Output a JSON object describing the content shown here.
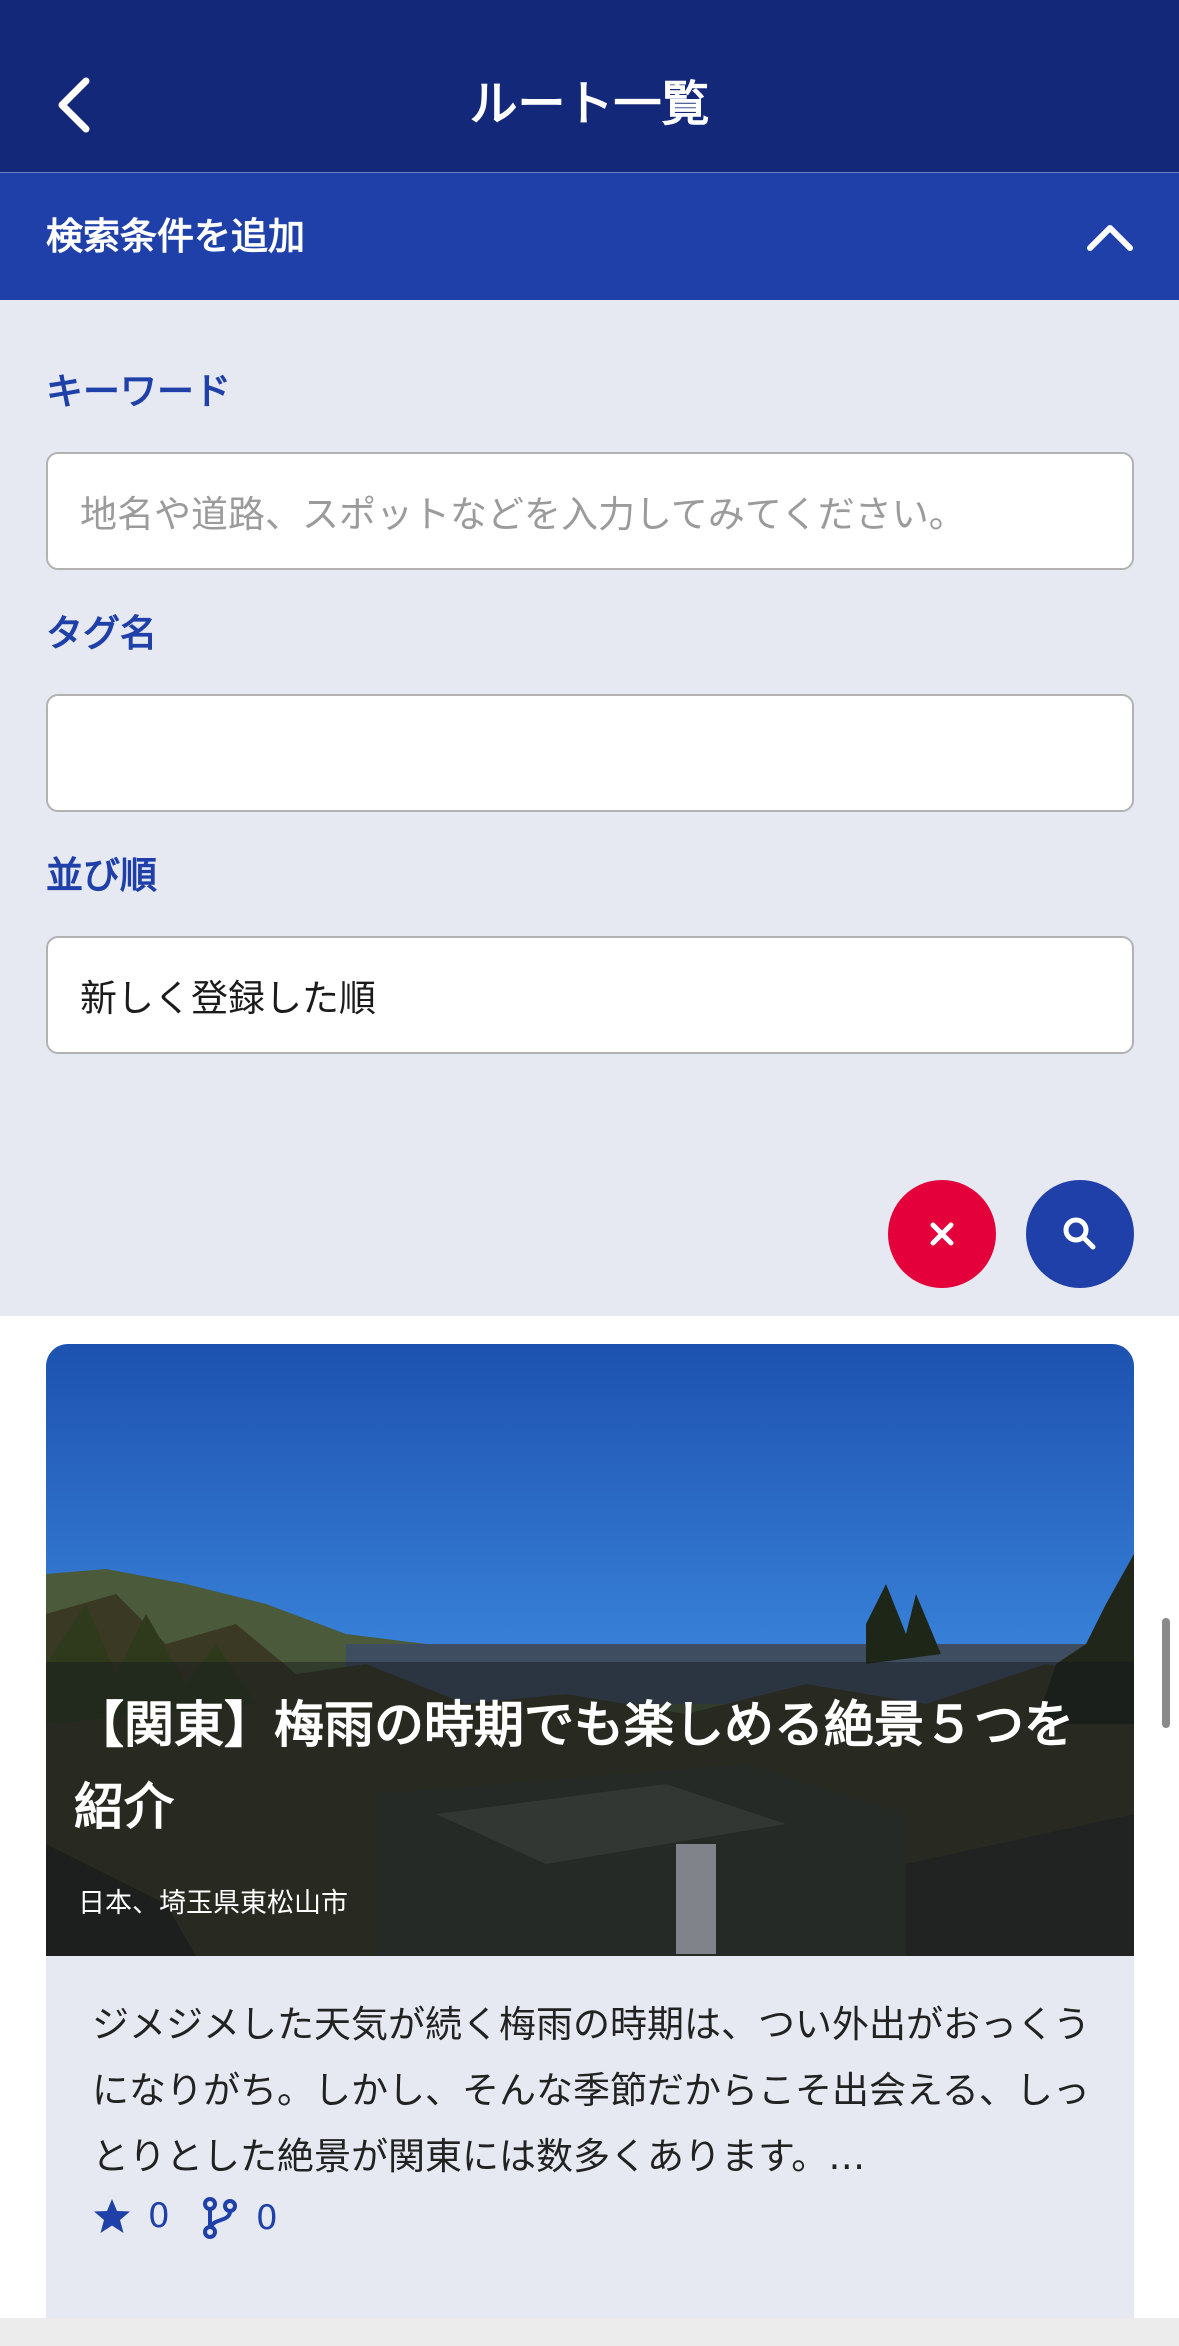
{
  "appbar": {
    "title": "ルート一覧",
    "back_icon": "chevron-left-icon"
  },
  "filter": {
    "header_label": "検索条件を追加",
    "collapse_icon": "chevron-up-icon",
    "keyword": {
      "label": "キーワード",
      "placeholder": "地名や道路、スポットなどを入力してみてください。",
      "value": ""
    },
    "tag": {
      "label": "タグ名",
      "value": ""
    },
    "sort": {
      "label": "並び順",
      "value": "新しく登録した順"
    },
    "clear_icon": "close-icon",
    "search_icon": "search-icon",
    "clear_color": "#e3003b",
    "search_color": "#1f40a8"
  },
  "routes": [
    {
      "title": "【関東】梅雨の時期でも楽しめる絶景５つを紹介",
      "location": "日本、埼玉県東松山市",
      "description": "ジメジメした天気が続く梅雨の時期は、つい外出がおっくうになりがち。しかし、そんな季節だからこそ出会える、しっとりとした絶景が関東には数多くあります。…",
      "likes": "0",
      "branches": "0",
      "likes_icon": "star-icon",
      "branches_icon": "branch-icon"
    }
  ],
  "colors": {
    "appbar": "#14287a",
    "accent": "#1f40a8",
    "panel": "#e6e9f2"
  }
}
